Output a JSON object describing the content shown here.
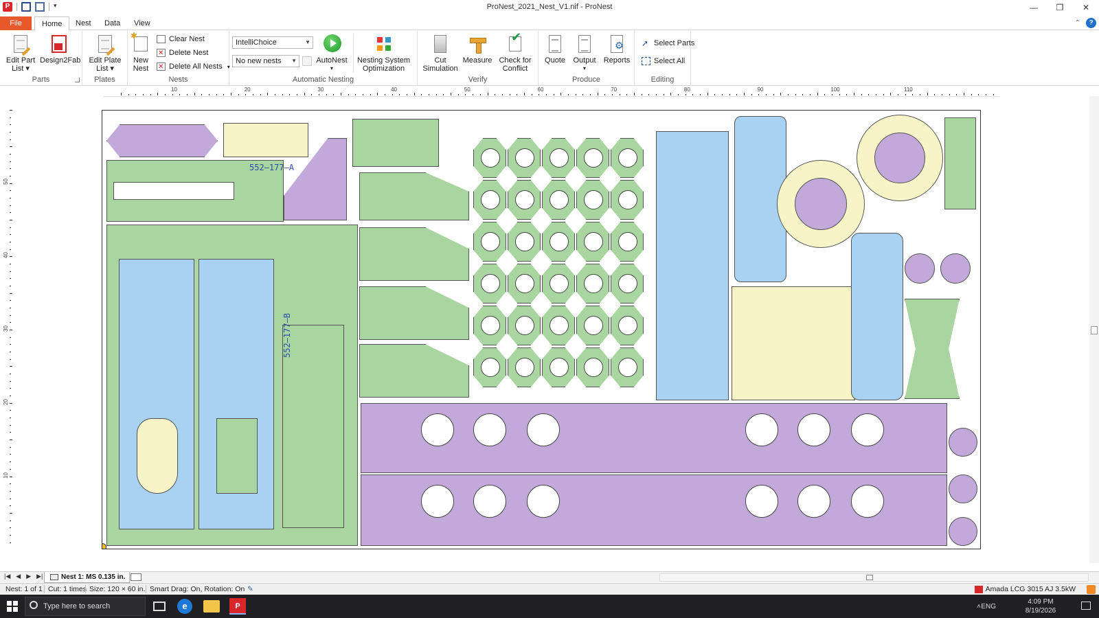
{
  "window": {
    "title": "ProNest_2021_Nest_V1.nif - ProNest",
    "controls": [
      "—",
      "❐",
      "✕"
    ]
  },
  "tabs": [
    {
      "label": "File"
    },
    {
      "label": "Home"
    },
    {
      "label": "Nest"
    },
    {
      "label": "Data"
    },
    {
      "label": "View"
    }
  ],
  "ribbon": {
    "parts": {
      "label": "Parts",
      "edit_part_list": "Edit Part List",
      "edit_part_list_l1": "Edit Part",
      "edit_part_list_l2": "List ▾",
      "design2fab": "Design2Fab"
    },
    "plates": {
      "label": "Plates",
      "edit_plate_list_l1": "Edit Plate",
      "edit_plate_list_l2": "List ▾"
    },
    "nests": {
      "label": "Nests",
      "new_nest_l1": "New",
      "new_nest_l2": "Nest",
      "clear_nest": "Clear Nest",
      "delete_nest": "Delete Nest",
      "delete_all_nests": "Delete All Nests"
    },
    "automatic_nesting": {
      "label": "Automatic Nesting",
      "strategy_value": "IntelliChoice",
      "nests_value": "No new nests",
      "autonest": "AutoNest",
      "nso_l1": "Nesting System",
      "nso_l2": "Optimization"
    },
    "verify": {
      "label": "Verify",
      "cut_sim_l1": "Cut",
      "cut_sim_l2": "Simulation",
      "measure": "Measure",
      "check_l1": "Check for",
      "check_l2": "Conflict"
    },
    "produce": {
      "label": "Produce",
      "quote": "Quote",
      "output": "Output",
      "reports": "Reports"
    },
    "editing": {
      "label": "Editing",
      "select_parts": "Select Parts",
      "select_all": "Select All"
    }
  },
  "ruler": {
    "h_labels": [
      "10",
      "20",
      "30",
      "40",
      "50",
      "60",
      "70",
      "80",
      "90",
      "100",
      "110"
    ],
    "v_labels": [
      "50",
      "40",
      "30",
      "20",
      "10"
    ]
  },
  "nest": {
    "part_label_a": "552–177–A",
    "part_label_b": "552–177–B"
  },
  "sheet_tab": {
    "label": "Nest 1: MS 0.135 in."
  },
  "status": {
    "nest": "Nest: 1 of 1",
    "cut": "Cut: 1 times",
    "size": "Size: 120 × 60 in.",
    "smart_drag": "Smart Drag: On, Rotation: On",
    "machine": "Amada LCG 3015 AJ 3.5kW"
  },
  "taskbar": {
    "search_placeholder": "Type here to search",
    "edge_glyph": "e",
    "pronest_glyph": "P",
    "lang": "ENG",
    "time": "4:09 PM",
    "date": "8/19/2026"
  },
  "colors": {
    "file_tab": "#e8582a",
    "green_part": "#a8d5a0",
    "blue_part": "#a9d1f2",
    "purple_part": "#c2a9da",
    "yellow_part": "#f7f5c8"
  }
}
